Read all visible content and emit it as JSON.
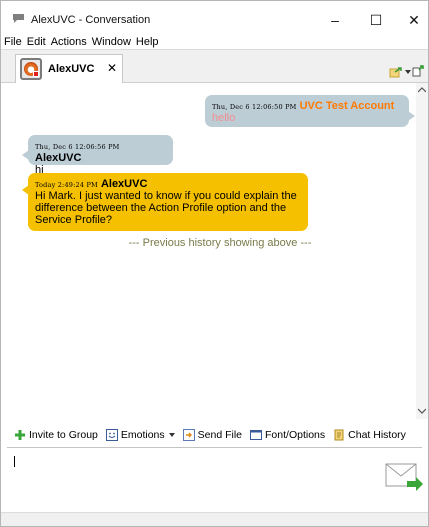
{
  "window": {
    "title": "AlexUVC - Conversation",
    "controls": {
      "minimize": "–",
      "maximize": "☐",
      "close": "✕"
    }
  },
  "menu": [
    "File",
    "Edit",
    "Actions",
    "Window",
    "Help"
  ],
  "tab": {
    "label": "AlexUVC",
    "close": "✕",
    "avatar_status": "red"
  },
  "messages": [
    {
      "timestamp": "Thu, Dec 6 12:06:50 PM",
      "sender": "UVC Test Account",
      "text": "hello",
      "side": "right",
      "color": "#bccdd6"
    },
    {
      "timestamp": "Thu, Dec 6 12:06:56 PM",
      "sender": "AlexUVC",
      "text": "hi",
      "side": "left",
      "color": "#bccdd6"
    },
    {
      "timestamp": "Today 2:49:24 PM",
      "sender": "AlexUVC",
      "text": "Hi Mark. I just wanted to know if you could explain the difference between the Action Profile option and the Service Profile?",
      "side": "left",
      "color": "#f5c000"
    }
  ],
  "history_note": "--- Previous history showing above ---",
  "toolbar": {
    "invite": "Invite to Group",
    "emotions": "Emotions",
    "send_file": "Send File",
    "font_options": "Font/Options",
    "chat_history": "Chat History"
  },
  "input": {
    "value": ""
  },
  "colors": {
    "accent_orange": "#ff7a00",
    "bubble_blue": "#bccdd6",
    "bubble_yellow": "#f5c000",
    "hello_pink": "#f38f8f",
    "history_text": "#7a7a4a"
  }
}
